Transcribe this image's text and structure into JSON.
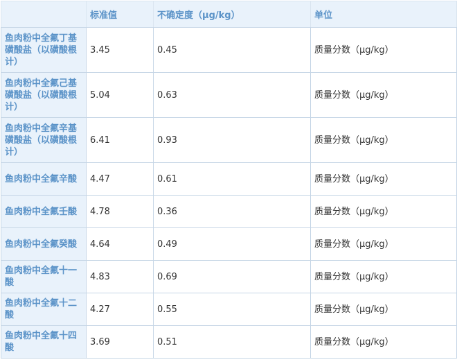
{
  "table": {
    "headers": [
      "",
      "标准值",
      "不确定度（μg/kg）",
      "单位"
    ],
    "rows": [
      {
        "name": "鱼肉粉中全氟丁基磺酸盐（以磺酸根计）",
        "value": "3.45",
        "uncertainty": "0.45",
        "unit": "质量分数（μg/kg）"
      },
      {
        "name": "鱼肉粉中全氟己基磺酸盐（以磺酸根计）",
        "value": "5.04",
        "uncertainty": "0.63",
        "unit": "质量分数（μg/kg）"
      },
      {
        "name": "鱼肉粉中全氟辛基磺酸盐（以磺酸根计）",
        "value": "6.41",
        "uncertainty": "0.93",
        "unit": "质量分数（μg/kg）"
      },
      {
        "name": "鱼肉粉中全氟辛酸",
        "value": "4.47",
        "uncertainty": "0.61",
        "unit": "质量分数（μg/kg）"
      },
      {
        "name": "鱼肉粉中全氟壬酸",
        "value": "4.78",
        "uncertainty": "0.36",
        "unit": "质量分数（μg/kg）"
      },
      {
        "name": "鱼肉粉中全氟癸酸",
        "value": "4.64",
        "uncertainty": "0.49",
        "unit": "质量分数（μg/kg）"
      },
      {
        "name": "鱼肉粉中全氟十一酸",
        "value": "4.83",
        "uncertainty": "0.69",
        "unit": "质量分数（μg/kg）"
      },
      {
        "name": "鱼肉粉中全氟十二酸",
        "value": "4.27",
        "uncertainty": "0.55",
        "unit": "质量分数（μg/kg）"
      },
      {
        "name": "鱼肉粉中全氟十四酸",
        "value": "3.69",
        "uncertainty": "0.51",
        "unit": "质量分数（μg/kg）"
      }
    ]
  }
}
